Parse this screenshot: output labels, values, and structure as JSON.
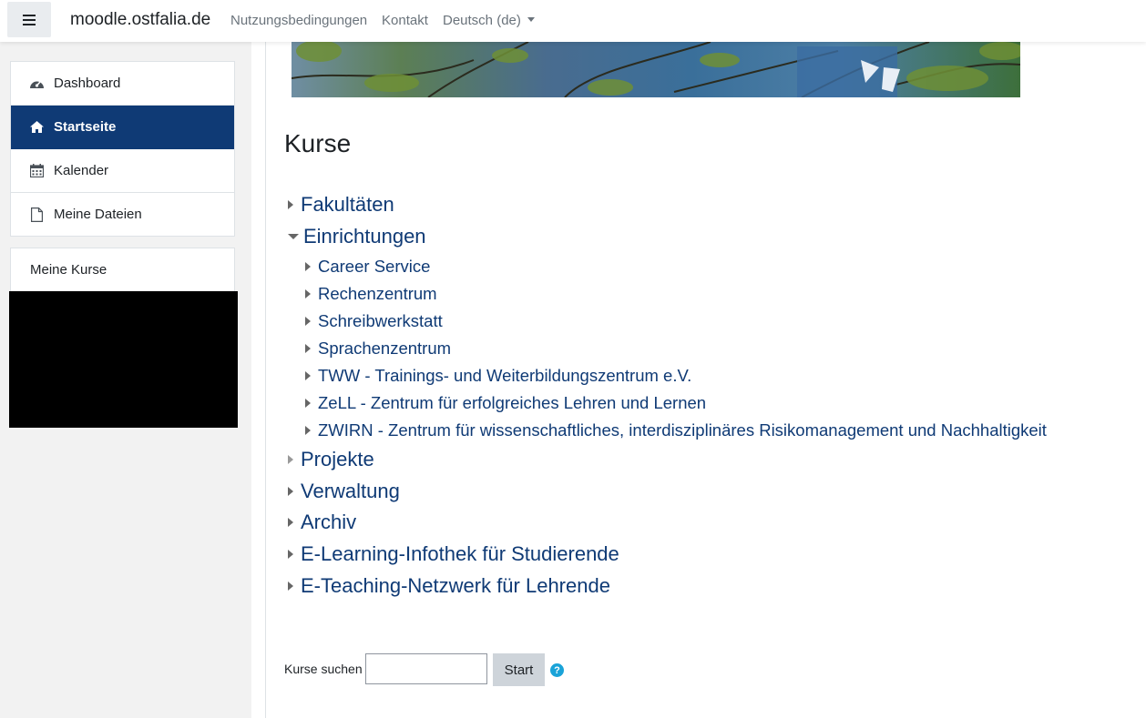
{
  "navbar": {
    "brand": "moodle.ostfalia.de",
    "links": [
      "Nutzungsbedingungen",
      "Kontakt"
    ],
    "language": "Deutsch (de)"
  },
  "drawer": {
    "items": [
      {
        "label": "Dashboard",
        "icon": "dashboard-icon"
      },
      {
        "label": "Startseite",
        "icon": "home-icon",
        "active": true
      },
      {
        "label": "Kalender",
        "icon": "calendar-icon"
      },
      {
        "label": "Meine Dateien",
        "icon": "file-icon"
      }
    ],
    "my_courses": "Meine Kurse"
  },
  "main": {
    "heading": "Kurse",
    "categories": [
      {
        "label": "Fakultäten",
        "expanded": false
      },
      {
        "label": "Einrichtungen",
        "expanded": true,
        "children": [
          "Career Service",
          "Rechenzentrum",
          "Schreibwerkstatt",
          "Sprachenzentrum",
          "TWW - Trainings- und Weiterbildungszentrum e.V.",
          "ZeLL - Zentrum für erfolgreiches Lehren und Lernen",
          "ZWIRN - Zentrum für wissenschaftliches, interdisziplinäres Risikomanagement und Nachhaltigkeit"
        ]
      },
      {
        "label": "Projekte",
        "expanded": false
      },
      {
        "label": "Verwaltung",
        "expanded": false
      },
      {
        "label": "Archiv",
        "expanded": false
      },
      {
        "label": "E-Learning-Infothek für Studierende",
        "expanded": false
      },
      {
        "label": "E-Teaching-Netzwerk für Lehrende",
        "expanded": false
      }
    ],
    "search": {
      "label": "Kurse suchen",
      "value": "",
      "button": "Start"
    }
  },
  "colors": {
    "primary": "#0f3a75",
    "drawer_bg": "#f2f2f2",
    "help": "#1aa3d8"
  }
}
